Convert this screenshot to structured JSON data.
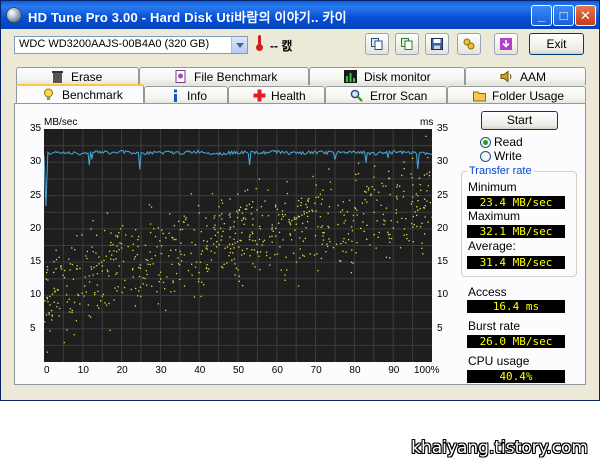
{
  "window": {
    "title": "HD Tune Pro 3.00 - Hard Disk Uti바람의 이야기..  카이",
    "min_label": "_",
    "max_label": "□",
    "close_label": "✕"
  },
  "toolbar": {
    "drive": "WDC WD3200AAJS-00B4A0 (320 GB)",
    "temperature": "-- 캜",
    "exit_label": "Exit",
    "icons": [
      "copy-icon",
      "copy-all-icon",
      "save-icon",
      "options-icon",
      "download-icon"
    ]
  },
  "tabs_top": [
    {
      "label": "Erase",
      "icon": "trash-icon"
    },
    {
      "label": "File Benchmark",
      "icon": "file-benchmark-icon"
    },
    {
      "label": "Disk monitor",
      "icon": "chart-icon"
    },
    {
      "label": "AAM",
      "icon": "speaker-icon"
    }
  ],
  "tabs_bottom": [
    {
      "label": "Benchmark",
      "icon": "bulb-icon",
      "active": true
    },
    {
      "label": "Info",
      "icon": "info-icon"
    },
    {
      "label": "Health",
      "icon": "health-cross-icon"
    },
    {
      "label": "Error Scan",
      "icon": "magnifier-icon"
    },
    {
      "label": "Folder Usage",
      "icon": "folder-icon"
    }
  ],
  "benchmark": {
    "start_label": "Start",
    "read_label": "Read",
    "write_label": "Write",
    "selected_mode": "Read",
    "transfer_rate_title": "Transfer rate",
    "minimum_label": "Minimum",
    "minimum_value": "23.4 MB/sec",
    "maximum_label": "Maximum",
    "maximum_value": "32.1 MB/sec",
    "average_label": "Average:",
    "average_value": "31.4 MB/sec",
    "access_label": "Access",
    "access_value": "16.4 ms",
    "burst_label": "Burst rate",
    "burst_value": "26.0 MB/sec",
    "cpu_label": "CPU usage",
    "cpu_value": "40.4%"
  },
  "chart_data": {
    "type": "line",
    "y_left_unit": "MB/sec",
    "y_right_unit": "ms",
    "ylim": [
      0,
      35
    ],
    "y_ticks": [
      "35",
      "30",
      "25",
      "20",
      "15",
      "10",
      "5"
    ],
    "x_ticks": [
      "0",
      "10",
      "20",
      "30",
      "40",
      "50",
      "60",
      "70",
      "80",
      "90",
      "100%"
    ],
    "grid": true,
    "series": [
      {
        "values_note": "",
        "color": "#4aa8d8"
      },
      {
        "color": "#e0e040"
      }
    ],
    "transfer_rate": {
      "x": [
        0,
        0.5,
        1,
        1.5,
        3,
        5,
        8,
        10,
        12,
        15,
        18,
        20,
        25,
        30,
        35,
        40,
        45,
        50,
        55,
        60,
        65,
        70,
        75,
        80,
        85,
        90,
        95,
        100
      ],
      "y": [
        31.0,
        23.4,
        31.5,
        31.2,
        31.6,
        31.4,
        31.5,
        31.2,
        31.6,
        31.5,
        31.4,
        31.6,
        31.3,
        31.5,
        31.4,
        31.6,
        31.3,
        31.5,
        31.4,
        31.6,
        31.3,
        31.5,
        31.4,
        31.6,
        31.3,
        31.5,
        31.4,
        31.2
      ]
    },
    "access_time_trend": {
      "x": [
        0,
        10,
        20,
        30,
        40,
        50,
        60,
        70,
        80,
        90,
        100
      ],
      "y": [
        10,
        13,
        15,
        16.5,
        18,
        19,
        20,
        21,
        22,
        23.5,
        25
      ]
    }
  },
  "caption": "khaiyang.tistory.com"
}
